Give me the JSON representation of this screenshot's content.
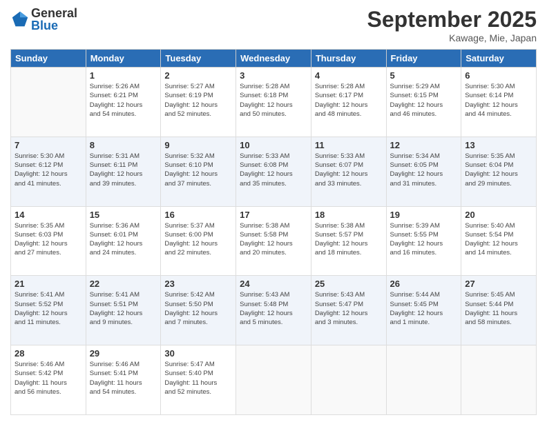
{
  "logo": {
    "general": "General",
    "blue": "Blue"
  },
  "title": "September 2025",
  "location": "Kawage, Mie, Japan",
  "days_header": [
    "Sunday",
    "Monday",
    "Tuesday",
    "Wednesday",
    "Thursday",
    "Friday",
    "Saturday"
  ],
  "weeks": [
    [
      {
        "day": "",
        "info": ""
      },
      {
        "day": "1",
        "info": "Sunrise: 5:26 AM\nSunset: 6:21 PM\nDaylight: 12 hours\nand 54 minutes."
      },
      {
        "day": "2",
        "info": "Sunrise: 5:27 AM\nSunset: 6:19 PM\nDaylight: 12 hours\nand 52 minutes."
      },
      {
        "day": "3",
        "info": "Sunrise: 5:28 AM\nSunset: 6:18 PM\nDaylight: 12 hours\nand 50 minutes."
      },
      {
        "day": "4",
        "info": "Sunrise: 5:28 AM\nSunset: 6:17 PM\nDaylight: 12 hours\nand 48 minutes."
      },
      {
        "day": "5",
        "info": "Sunrise: 5:29 AM\nSunset: 6:15 PM\nDaylight: 12 hours\nand 46 minutes."
      },
      {
        "day": "6",
        "info": "Sunrise: 5:30 AM\nSunset: 6:14 PM\nDaylight: 12 hours\nand 44 minutes."
      }
    ],
    [
      {
        "day": "7",
        "info": "Sunrise: 5:30 AM\nSunset: 6:12 PM\nDaylight: 12 hours\nand 41 minutes."
      },
      {
        "day": "8",
        "info": "Sunrise: 5:31 AM\nSunset: 6:11 PM\nDaylight: 12 hours\nand 39 minutes."
      },
      {
        "day": "9",
        "info": "Sunrise: 5:32 AM\nSunset: 6:10 PM\nDaylight: 12 hours\nand 37 minutes."
      },
      {
        "day": "10",
        "info": "Sunrise: 5:33 AM\nSunset: 6:08 PM\nDaylight: 12 hours\nand 35 minutes."
      },
      {
        "day": "11",
        "info": "Sunrise: 5:33 AM\nSunset: 6:07 PM\nDaylight: 12 hours\nand 33 minutes."
      },
      {
        "day": "12",
        "info": "Sunrise: 5:34 AM\nSunset: 6:05 PM\nDaylight: 12 hours\nand 31 minutes."
      },
      {
        "day": "13",
        "info": "Sunrise: 5:35 AM\nSunset: 6:04 PM\nDaylight: 12 hours\nand 29 minutes."
      }
    ],
    [
      {
        "day": "14",
        "info": "Sunrise: 5:35 AM\nSunset: 6:03 PM\nDaylight: 12 hours\nand 27 minutes."
      },
      {
        "day": "15",
        "info": "Sunrise: 5:36 AM\nSunset: 6:01 PM\nDaylight: 12 hours\nand 24 minutes."
      },
      {
        "day": "16",
        "info": "Sunrise: 5:37 AM\nSunset: 6:00 PM\nDaylight: 12 hours\nand 22 minutes."
      },
      {
        "day": "17",
        "info": "Sunrise: 5:38 AM\nSunset: 5:58 PM\nDaylight: 12 hours\nand 20 minutes."
      },
      {
        "day": "18",
        "info": "Sunrise: 5:38 AM\nSunset: 5:57 PM\nDaylight: 12 hours\nand 18 minutes."
      },
      {
        "day": "19",
        "info": "Sunrise: 5:39 AM\nSunset: 5:55 PM\nDaylight: 12 hours\nand 16 minutes."
      },
      {
        "day": "20",
        "info": "Sunrise: 5:40 AM\nSunset: 5:54 PM\nDaylight: 12 hours\nand 14 minutes."
      }
    ],
    [
      {
        "day": "21",
        "info": "Sunrise: 5:41 AM\nSunset: 5:52 PM\nDaylight: 12 hours\nand 11 minutes."
      },
      {
        "day": "22",
        "info": "Sunrise: 5:41 AM\nSunset: 5:51 PM\nDaylight: 12 hours\nand 9 minutes."
      },
      {
        "day": "23",
        "info": "Sunrise: 5:42 AM\nSunset: 5:50 PM\nDaylight: 12 hours\nand 7 minutes."
      },
      {
        "day": "24",
        "info": "Sunrise: 5:43 AM\nSunset: 5:48 PM\nDaylight: 12 hours\nand 5 minutes."
      },
      {
        "day": "25",
        "info": "Sunrise: 5:43 AM\nSunset: 5:47 PM\nDaylight: 12 hours\nand 3 minutes."
      },
      {
        "day": "26",
        "info": "Sunrise: 5:44 AM\nSunset: 5:45 PM\nDaylight: 12 hours\nand 1 minute."
      },
      {
        "day": "27",
        "info": "Sunrise: 5:45 AM\nSunset: 5:44 PM\nDaylight: 11 hours\nand 58 minutes."
      }
    ],
    [
      {
        "day": "28",
        "info": "Sunrise: 5:46 AM\nSunset: 5:42 PM\nDaylight: 11 hours\nand 56 minutes."
      },
      {
        "day": "29",
        "info": "Sunrise: 5:46 AM\nSunset: 5:41 PM\nDaylight: 11 hours\nand 54 minutes."
      },
      {
        "day": "30",
        "info": "Sunrise: 5:47 AM\nSunset: 5:40 PM\nDaylight: 11 hours\nand 52 minutes."
      },
      {
        "day": "",
        "info": ""
      },
      {
        "day": "",
        "info": ""
      },
      {
        "day": "",
        "info": ""
      },
      {
        "day": "",
        "info": ""
      }
    ]
  ]
}
